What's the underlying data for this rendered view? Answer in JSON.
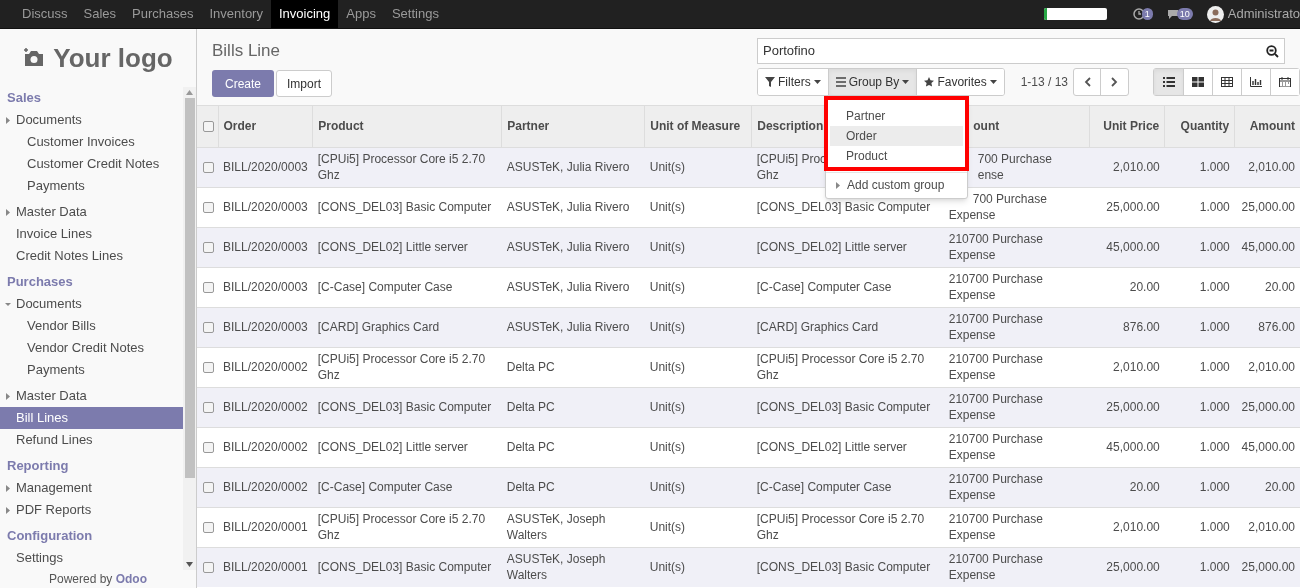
{
  "top_menu": [
    {
      "label": "Discuss",
      "selected": false
    },
    {
      "label": "Sales",
      "selected": false
    },
    {
      "label": "Purchases",
      "selected": false
    },
    {
      "label": "Inventory",
      "selected": false
    },
    {
      "label": "Invoicing",
      "selected": true
    },
    {
      "label": "Apps",
      "selected": false
    },
    {
      "label": "Settings",
      "selected": false
    }
  ],
  "systray": {
    "progress": {
      "level": 0.05
    },
    "activity_count": "1",
    "message_count": "10",
    "user": "Administrato"
  },
  "sidebar": {
    "logo": "Your logo",
    "footer": "Powered by **Odoo**",
    "sections": [
      {
        "title": "Sales",
        "items": [
          {
            "kind": "folder",
            "label": "Documents",
            "expanded": false,
            "selected": false,
            "children": [
              {
                "label": "Customer Invoices",
                "selected": false
              },
              {
                "label": "Customer Credit Notes",
                "selected": false
              },
              {
                "label": "Payments",
                "selected": false
              }
            ]
          },
          {
            "kind": "folder",
            "label": "Master Data",
            "expanded": false,
            "selected": false
          },
          {
            "kind": "link",
            "label": "Invoice Lines",
            "selected": false
          },
          {
            "kind": "link",
            "label": "Credit Notes Lines",
            "selected": false
          }
        ]
      },
      {
        "title": "Purchases",
        "items": [
          {
            "kind": "folder",
            "label": "Documents",
            "expanded": true,
            "selected": false,
            "children": [
              {
                "label": "Vendor Bills",
                "selected": false
              },
              {
                "label": "Vendor Credit Notes",
                "selected": false
              },
              {
                "label": "Payments",
                "selected": false
              }
            ]
          },
          {
            "kind": "folder",
            "label": "Master Data",
            "expanded": false,
            "selected": false
          },
          {
            "kind": "link",
            "label": "Bill Lines",
            "selected": true
          },
          {
            "kind": "link",
            "label": "Refund Lines",
            "selected": false
          }
        ]
      },
      {
        "title": "Reporting",
        "items": [
          {
            "kind": "folder",
            "label": "Management",
            "expanded": false,
            "selected": false
          },
          {
            "kind": "folder",
            "label": "PDF Reports",
            "expanded": false,
            "selected": false
          }
        ]
      },
      {
        "title": "Configuration",
        "items": [
          {
            "kind": "link",
            "label": "Settings",
            "selected": false
          }
        ]
      }
    ]
  },
  "breadcrumb": "Bills Line",
  "buttons": [
    "Create",
    "Import"
  ],
  "search": {
    "value": "Portofino"
  },
  "search_options": [
    {
      "label": "Filters",
      "selected": false
    },
    {
      "label": "Group By",
      "selected": true
    },
    {
      "label": "Favorites",
      "selected": false
    }
  ],
  "pager": "1-13 / 13",
  "views": [
    {
      "selected": true
    },
    {
      "selected": false
    },
    {
      "selected": false
    },
    {
      "selected": false
    },
    {
      "selected": false
    }
  ],
  "group_by_menu": {
    "items": [
      {
        "label": "Partner",
        "selected": false
      },
      {
        "label": "Order",
        "selected": true
      },
      {
        "label": "Product",
        "selected": false
      }
    ],
    "custom": "Add custom group"
  },
  "table": {
    "all_checked": false,
    "columns": [
      "Order",
      "Product",
      "Partner",
      "Unit of Measure",
      "Description",
      "ount",
      "Unit Price",
      "Quantity",
      "Amount"
    ],
    "rows": [
      {
        "checked": false,
        "cells": [
          "BILL/2020/0003",
          "[CPUi5] Processor Core i5 2.70 Ghz",
          "ASUSTeK, Julia Rivero",
          "Unit(s)",
          "[CPUi5] Proc\nGhz",
          "700 Purchase\nense",
          "2,010.00",
          "1.000",
          "2,010.00"
        ]
      },
      {
        "checked": false,
        "cells": [
          "BILL/2020/0003",
          "[CONS_DEL03] Basic Computer",
          "ASUSTeK, Julia Rivero",
          "Unit(s)",
          "[CONS_DEL03] Basic Computer",
          "700 Purchase\nExpense",
          "25,000.00",
          "1.000",
          "25,000.00"
        ]
      },
      {
        "checked": false,
        "cells": [
          "BILL/2020/0003",
          "[CONS_DEL02] Little server",
          "ASUSTeK, Julia Rivero",
          "Unit(s)",
          "[CONS_DEL02] Little server",
          "210700 Purchase Expense",
          "45,000.00",
          "1.000",
          "45,000.00"
        ]
      },
      {
        "checked": false,
        "cells": [
          "BILL/2020/0003",
          "[C-Case] Computer Case",
          "ASUSTeK, Julia Rivero",
          "Unit(s)",
          "[C-Case] Computer Case",
          "210700 Purchase Expense",
          "20.00",
          "1.000",
          "20.00"
        ]
      },
      {
        "checked": false,
        "cells": [
          "BILL/2020/0003",
          "[CARD] Graphics Card",
          "ASUSTeK, Julia Rivero",
          "Unit(s)",
          "[CARD] Graphics Card",
          "210700 Purchase Expense",
          "876.00",
          "1.000",
          "876.00"
        ]
      },
      {
        "checked": false,
        "cells": [
          "BILL/2020/0002",
          "[CPUi5] Processor Core i5 2.70 Ghz",
          "Delta PC",
          "Unit(s)",
          "[CPUi5] Processor Core i5 2.70 Ghz",
          "210700 Purchase Expense",
          "2,010.00",
          "1.000",
          "2,010.00"
        ]
      },
      {
        "checked": false,
        "cells": [
          "BILL/2020/0002",
          "[CONS_DEL03] Basic Computer",
          "Delta PC",
          "Unit(s)",
          "[CONS_DEL03] Basic Computer",
          "210700 Purchase Expense",
          "25,000.00",
          "1.000",
          "25,000.00"
        ]
      },
      {
        "checked": false,
        "cells": [
          "BILL/2020/0002",
          "[CONS_DEL02] Little server",
          "Delta PC",
          "Unit(s)",
          "[CONS_DEL02] Little server",
          "210700 Purchase Expense",
          "45,000.00",
          "1.000",
          "45,000.00"
        ]
      },
      {
        "checked": false,
        "cells": [
          "BILL/2020/0002",
          "[C-Case] Computer Case",
          "Delta PC",
          "Unit(s)",
          "[C-Case] Computer Case",
          "210700 Purchase Expense",
          "20.00",
          "1.000",
          "20.00"
        ]
      },
      {
        "checked": false,
        "cells": [
          "BILL/2020/0001",
          "[CPUi5] Processor Core i5 2.70 Ghz",
          "ASUSTeK, Joseph Walters",
          "Unit(s)",
          "[CPUi5] Processor Core i5 2.70 Ghz",
          "210700 Purchase Expense",
          "2,010.00",
          "1.000",
          "2,010.00"
        ]
      },
      {
        "checked": false,
        "cells": [
          "BILL/2020/0001",
          "[CONS_DEL03] Basic Computer",
          "ASUSTeK, Joseph Walters",
          "Unit(s)",
          "[CONS_DEL03] Basic Computer",
          "210700 Purchase Expense",
          "25,000.00",
          "1.000",
          "25,000.00"
        ]
      }
    ]
  }
}
